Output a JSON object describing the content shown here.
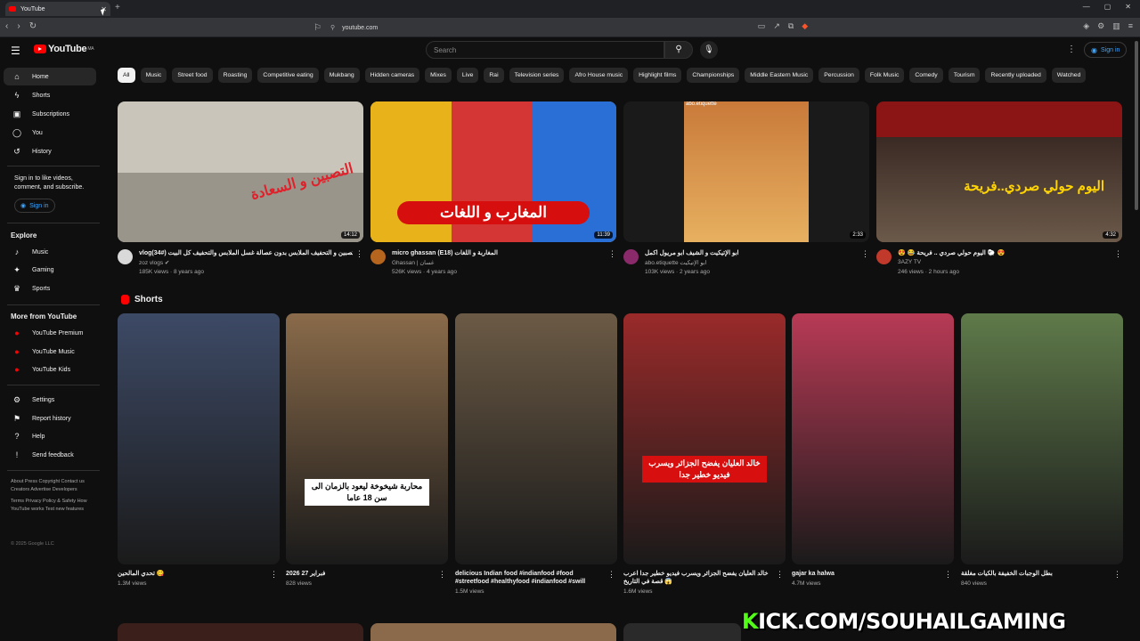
{
  "browser": {
    "tab_title": "YouTube",
    "url": "youtube.com",
    "close_glyph": "✕",
    "new_tab_glyph": "+"
  },
  "header": {
    "logo_text": "YouTube",
    "logo_badge": "MA",
    "search_placeholder": "Search",
    "sign_in": "Sign in"
  },
  "sidebar": {
    "main": [
      {
        "label": "Home",
        "icon": "home-icon"
      },
      {
        "label": "Shorts",
        "icon": "shorts-icon"
      },
      {
        "label": "Subscriptions",
        "icon": "subscriptions-icon"
      },
      {
        "label": "You",
        "icon": "you-icon"
      },
      {
        "label": "History",
        "icon": "history-icon"
      }
    ],
    "signin_note": "Sign in to like videos, comment, and subscribe.",
    "signin_button": "Sign in",
    "explore_heading": "Explore",
    "explore": [
      {
        "label": "Music",
        "icon": "music-icon"
      },
      {
        "label": "Gaming",
        "icon": "gaming-icon"
      },
      {
        "label": "Sports",
        "icon": "sports-icon"
      }
    ],
    "more_heading": "More from YouTube",
    "more": [
      {
        "label": "YouTube Premium",
        "icon": "youtube-premium-icon"
      },
      {
        "label": "YouTube Music",
        "icon": "youtube-music-icon"
      },
      {
        "label": "YouTube Kids",
        "icon": "youtube-kids-icon"
      }
    ],
    "settings": [
      {
        "label": "Settings",
        "icon": "gear-icon"
      },
      {
        "label": "Report history",
        "icon": "flag-icon"
      },
      {
        "label": "Help",
        "icon": "help-icon"
      },
      {
        "label": "Send feedback",
        "icon": "feedback-icon"
      }
    ],
    "footer_links_1": "About  Press  Copyright  Contact us  Creators  Advertise  Developers",
    "footer_links_2": "Terms  Privacy  Policy & Safety  How YouTube works  Test new features",
    "copyright": "© 2025 Google LLC"
  },
  "chips": [
    "All",
    "Music",
    "Street food",
    "Roasting",
    "Competitive eating",
    "Mukbang",
    "Hidden cameras",
    "Mixes",
    "Live",
    "Rai",
    "Television series",
    "Afro House music",
    "Highlight films",
    "Championships",
    "Middle Eastern Music",
    "Percussion",
    "Folk Music",
    "Comedy",
    "Tourism",
    "Recently uploaded",
    "Watched"
  ],
  "videos": [
    {
      "title": "vlog(34#) طريقة في التصبين و التحفيف الملابس بدون عصالة   غسل الملابس والتحفيف كل البيت",
      "channel": "zoz vlogs ✔",
      "stats": "185K views · 8 years ago",
      "duration": "14:12",
      "overlay": "التصبين و السعادة",
      "thumb_color": "#c9c5bb",
      "avatar_color": "#d9d9d9"
    },
    {
      "title": "micro ghassan (E18) المغاربة و اللغات",
      "channel": "Ghassan | غسان",
      "stats": "526K views · 4 years ago",
      "duration": "11:39",
      "overlay": "المغارب و اللغات",
      "thumb_color": "#e8b21b",
      "avatar_color": "#b5651d"
    },
    {
      "title": "ابو الإتيكيت و الشيف ابو مريول اكمل",
      "channel": "abo.etiquette ابو الإتيكيت",
      "stats": "103K views · 2 years ago",
      "duration": "2:33",
      "overlay": "abo.etiquette",
      "thumb_color": "#1a1a1a",
      "avatar_color": "#8a2a6a"
    },
    {
      "title": "😍 😂 اليوم حولي صردي .. فريحة 🐑 😍",
      "channel": "3AZY TV",
      "stats": "246 views · 2 hours ago",
      "duration": "4:32",
      "overlay": "اليوم حولي صردي..فريحة",
      "thumb_color": "#8b1414",
      "avatar_color": "#c0392b"
    }
  ],
  "shorts_heading": "Shorts",
  "shorts": [
    {
      "title": "تحدي المالحين 😋",
      "views": "1.3M views",
      "caption": "",
      "thumb_color": "#3d4a66"
    },
    {
      "title": "2026 27 فبراير",
      "views": "828 views",
      "caption": "محاربة شيخوخة ليعود بالزمان الى سن 18 عاما",
      "thumb_color": "#8a6b4a"
    },
    {
      "title": "delicious Indian food #indianfood #food #streetfood #healthyfood #indianfood #swill",
      "views": "1.5M views",
      "caption": "",
      "thumb_color": "#6b5a45"
    },
    {
      "title": "خالد العليان يفضح الجزائر ويسرب فيديو خطير جدا اعرب قصة في التاريخ 😱",
      "views": "1.6M views",
      "caption": "خالد العليان يفضح الجزائر ويسرب فيديو خطير جدا",
      "thumb_color": "#9a2a2a"
    },
    {
      "title": "gajar ka halwa",
      "views": "4.7M views",
      "caption": "",
      "thumb_color": "#b83a55"
    },
    {
      "title": "بطل الوجبات الخفيفة بالكيات مغلقة",
      "views": "840 views",
      "caption": "",
      "thumb_color": "#5f7a4a"
    }
  ],
  "watermark": "KICK.COM/SOUHAILGAMING",
  "colors": {
    "accent": "#ff0000",
    "link": "#3ea6ff",
    "bg": "#0f0f0f",
    "chip_bg": "#272727"
  }
}
